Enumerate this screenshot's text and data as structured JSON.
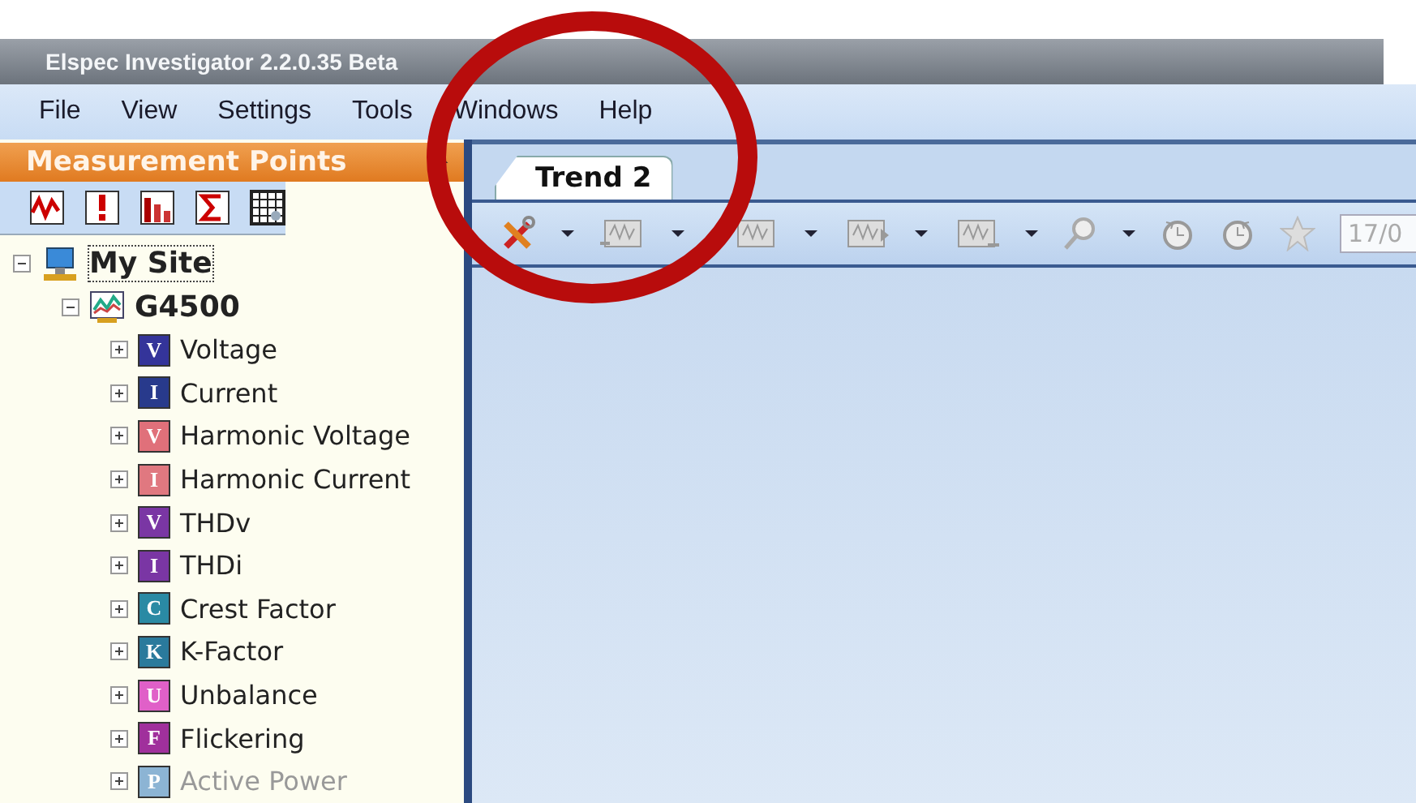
{
  "window": {
    "title": "Elspec Investigator 2.2.0.35 Beta"
  },
  "menu": [
    "File",
    "View",
    "Settings",
    "Tools",
    "Windows",
    "Help"
  ],
  "panel": {
    "title": "Measurement Points",
    "tree": [
      {
        "label": "My Site",
        "kind": "site",
        "expanded": true,
        "children": [
          {
            "label": "G4500",
            "kind": "device",
            "expanded": true,
            "children": [
              {
                "label": "Voltage",
                "kind": "channel",
                "badge": "V",
                "color": "#34349a",
                "expanded": false
              },
              {
                "label": "Current",
                "kind": "channel",
                "badge": "I",
                "color": "#283a8c",
                "expanded": false
              },
              {
                "label": "Harmonic Voltage",
                "kind": "channel",
                "badge": "V",
                "color": "#e0707a",
                "expanded": false
              },
              {
                "label": "Harmonic Current",
                "kind": "channel",
                "badge": "I",
                "color": "#e07880",
                "expanded": false
              },
              {
                "label": "THDv",
                "kind": "channel",
                "badge": "V",
                "color": "#7a36a4",
                "expanded": false
              },
              {
                "label": "THDi",
                "kind": "channel",
                "badge": "I",
                "color": "#7a36a4",
                "expanded": false
              },
              {
                "label": "Crest Factor",
                "kind": "channel",
                "badge": "C",
                "color": "#2a8aa4",
                "expanded": false
              },
              {
                "label": "K-Factor",
                "kind": "channel",
                "badge": "K",
                "color": "#2a7a9c",
                "expanded": false
              },
              {
                "label": "Unbalance",
                "kind": "channel",
                "badge": "U",
                "color": "#e060c8",
                "expanded": false
              },
              {
                "label": "Flickering",
                "kind": "channel",
                "badge": "F",
                "color": "#a0309c",
                "expanded": false
              },
              {
                "label": "Active Power",
                "kind": "channel",
                "badge": "P",
                "color": "#8cb4d4",
                "expanded": false
              }
            ]
          }
        ]
      }
    ]
  },
  "tabs": [
    {
      "label": "Trend 2",
      "selected": true
    }
  ],
  "date_field": {
    "value": "17/0"
  }
}
